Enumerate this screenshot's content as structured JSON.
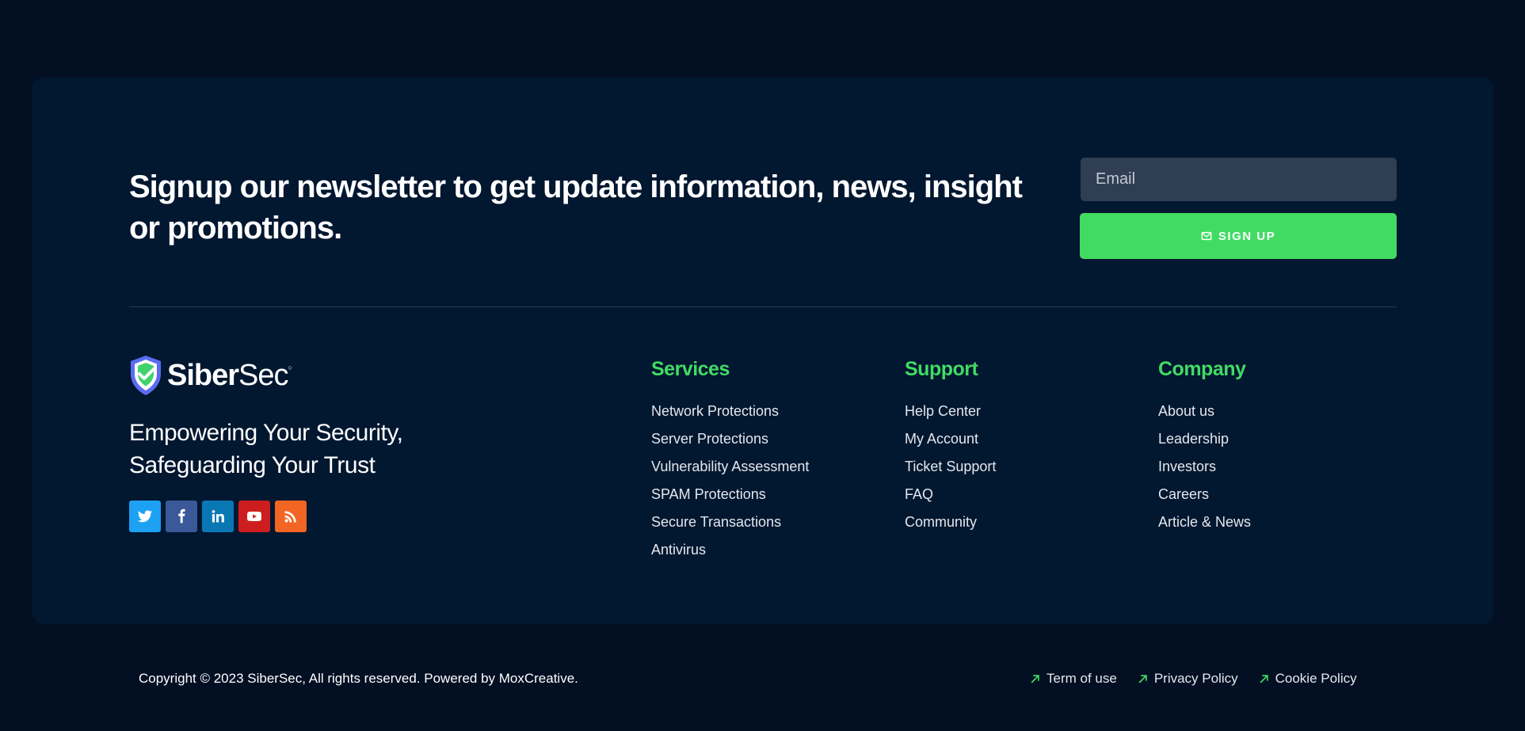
{
  "newsletter": {
    "title": "Signup our newsletter to get update information, news, insight or promotions.",
    "email_placeholder": "Email",
    "signup_label": "SIGN UP"
  },
  "brand": {
    "name_bold": "Siber",
    "name_light": "Sec",
    "tagline": "Empowering Your Security, Safeguarding Your Trust"
  },
  "socials": [
    {
      "name": "twitter-icon",
      "color": "#1da1f2"
    },
    {
      "name": "facebook-icon",
      "color": "#3b5998"
    },
    {
      "name": "linkedin-icon",
      "color": "#0a77b5"
    },
    {
      "name": "youtube-icon",
      "color": "#cc1e1e"
    },
    {
      "name": "rss-icon",
      "color": "#f26522"
    }
  ],
  "columns": {
    "services": {
      "title": "Services",
      "items": [
        "Network Protections",
        "Server Protections",
        "Vulnerability Assessment",
        "SPAM Protections",
        "Secure Transactions",
        "Antivirus"
      ]
    },
    "support": {
      "title": "Support",
      "items": [
        "Help Center",
        "My Account",
        "Ticket Support",
        "FAQ",
        "Community"
      ]
    },
    "company": {
      "title": "Company",
      "items": [
        "About us",
        "Leadership",
        "Investors",
        "Careers",
        "Article & News"
      ]
    }
  },
  "footer": {
    "copyright": "Copyright © 2023 SiberSec, All rights reserved. Powered by MoxCreative.",
    "links": [
      "Term of use",
      "Privacy Policy",
      "Cookie Policy"
    ]
  },
  "colors": {
    "accent": "#41db64",
    "background": "#030f22",
    "card": "#021730"
  }
}
